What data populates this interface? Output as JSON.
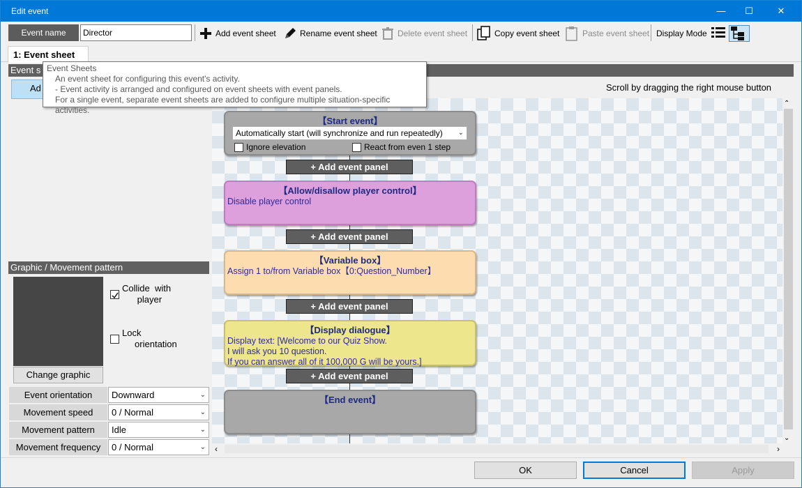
{
  "window": {
    "title": "Edit event",
    "minimize": "—",
    "maximize": "☐",
    "close": "✕"
  },
  "toolbar": {
    "event_name_label": "Event name",
    "event_name_value": "Director",
    "add_sheet": "Add event sheet",
    "rename_sheet": "Rename event sheet",
    "delete_sheet": "Delete event sheet",
    "copy_sheet": "Copy event sheet",
    "paste_sheet": "Paste event sheet",
    "display_mode": "Display Mode"
  },
  "tabs": [
    {
      "label": "1: Event sheet"
    }
  ],
  "left": {
    "event_sheet_hdr": "Event s",
    "add_button": "Ad",
    "graphic_hdr": "Graphic / Movement pattern",
    "collide_label": "Collide  with\n      player",
    "lock_label": "Lock\n     orientation",
    "change_graphic": "Change graphic",
    "props": [
      {
        "label": "Event orientation",
        "value": "Downward"
      },
      {
        "label": "Movement speed",
        "value": "0 / Normal"
      },
      {
        "label": "Movement pattern",
        "value": "Idle"
      },
      {
        "label": "Movement frequency",
        "value": "0 / Normal"
      }
    ]
  },
  "tooltip": {
    "title": "Event Sheets",
    "line1": "An event sheet for configuring this event's activity.",
    "line2": "- Event activity is arranged and configured on event sheets with event panels.",
    "line3": "For a single event, separate event sheets are added to configure multiple situation-specific activities."
  },
  "canvas": {
    "hint": "Scroll by dragging the right mouse button",
    "add_panel": "+ Add event panel",
    "start": {
      "title": "【Start event】",
      "dropdown": "Automatically start (will synchronize and run repeatedly)",
      "ignore_elevation": "Ignore elevation",
      "react_step": "React from even 1 step"
    },
    "panels": [
      {
        "title": "【Allow/disallow player control】",
        "body": "Disable player control",
        "color": "#dda0dd"
      },
      {
        "title": "【Variable box】",
        "body": "Assign 1 to/from Variable box【0:Question_Number】",
        "color": "#fddcaf"
      },
      {
        "title": "【Display dialogue】",
        "body": "Display text: [Welcome to our Quiz Show.\nI will ask you 10 question.\nIf you can answer all of it 100,000 G will be yours.]",
        "color": "#eee68c"
      }
    ],
    "end": {
      "title": "【End event】"
    }
  },
  "footer": {
    "ok": "OK",
    "cancel": "Cancel",
    "apply": "Apply"
  }
}
